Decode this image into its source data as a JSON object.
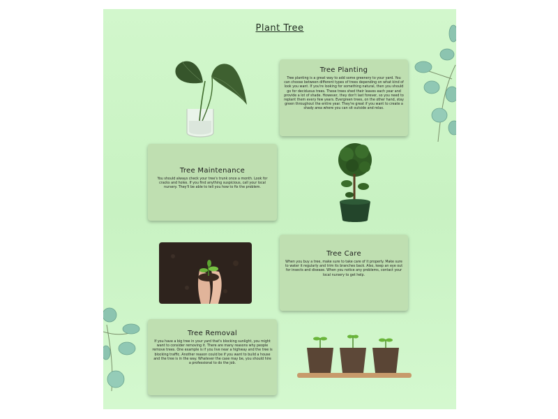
{
  "page": {
    "title": "Plant Tree"
  },
  "sections": [
    {
      "heading": "Tree Planting",
      "body": "Tree planting is a great way to add some greenery to your yard. You can choose between different types of trees depending on what kind of look you want. If you're looking for something natural, then you should go for deciduous trees. These trees shed their leaves each year and provide a lot of shade. However, they don't last forever, so you need to replant them every few years. Evergreen trees, on the other hand, stay green throughout the entire year. They're great if you want to create a shady area where you can sit outside and relax."
    },
    {
      "heading": "Tree Maintenance",
      "body": "You should always check your tree's trunk once a month. Look for cracks and holes. If you find anything suspicious, call your local nursery. They'll be able to tell you how to fix the problem."
    },
    {
      "heading": "Tree Care",
      "body": "When you buy a tree, make sure to take care of it properly. Make sure to water it regularly and trim its branches back. Also, keep an eye out for insects and disease. When you notice any problems, contact your local nursery to get help."
    },
    {
      "heading": "Tree Removal",
      "body": "If you have a big tree in your yard that's blocking sunlight, you might want to consider removing it. There are many reasons why people remove trees. One example is if you live near a highway and the tree is blocking traffic. Another reason could be if you want to build a house and the tree is in the way. Whatever the case may be, you should hire a professional to do the job."
    }
  ],
  "images": {
    "plant": "plant-in-glass-vase-image",
    "tree": "potted-topiary-tree-image",
    "hands": "hands-holding-seedling-image",
    "seedlings": "seedlings-in-pots-image",
    "eucalyptus": "eucalyptus-branch-decoration"
  },
  "colors": {
    "background": "#c8f2c2",
    "card": "#bfdfb1",
    "leaf": "#8cc4b0"
  }
}
